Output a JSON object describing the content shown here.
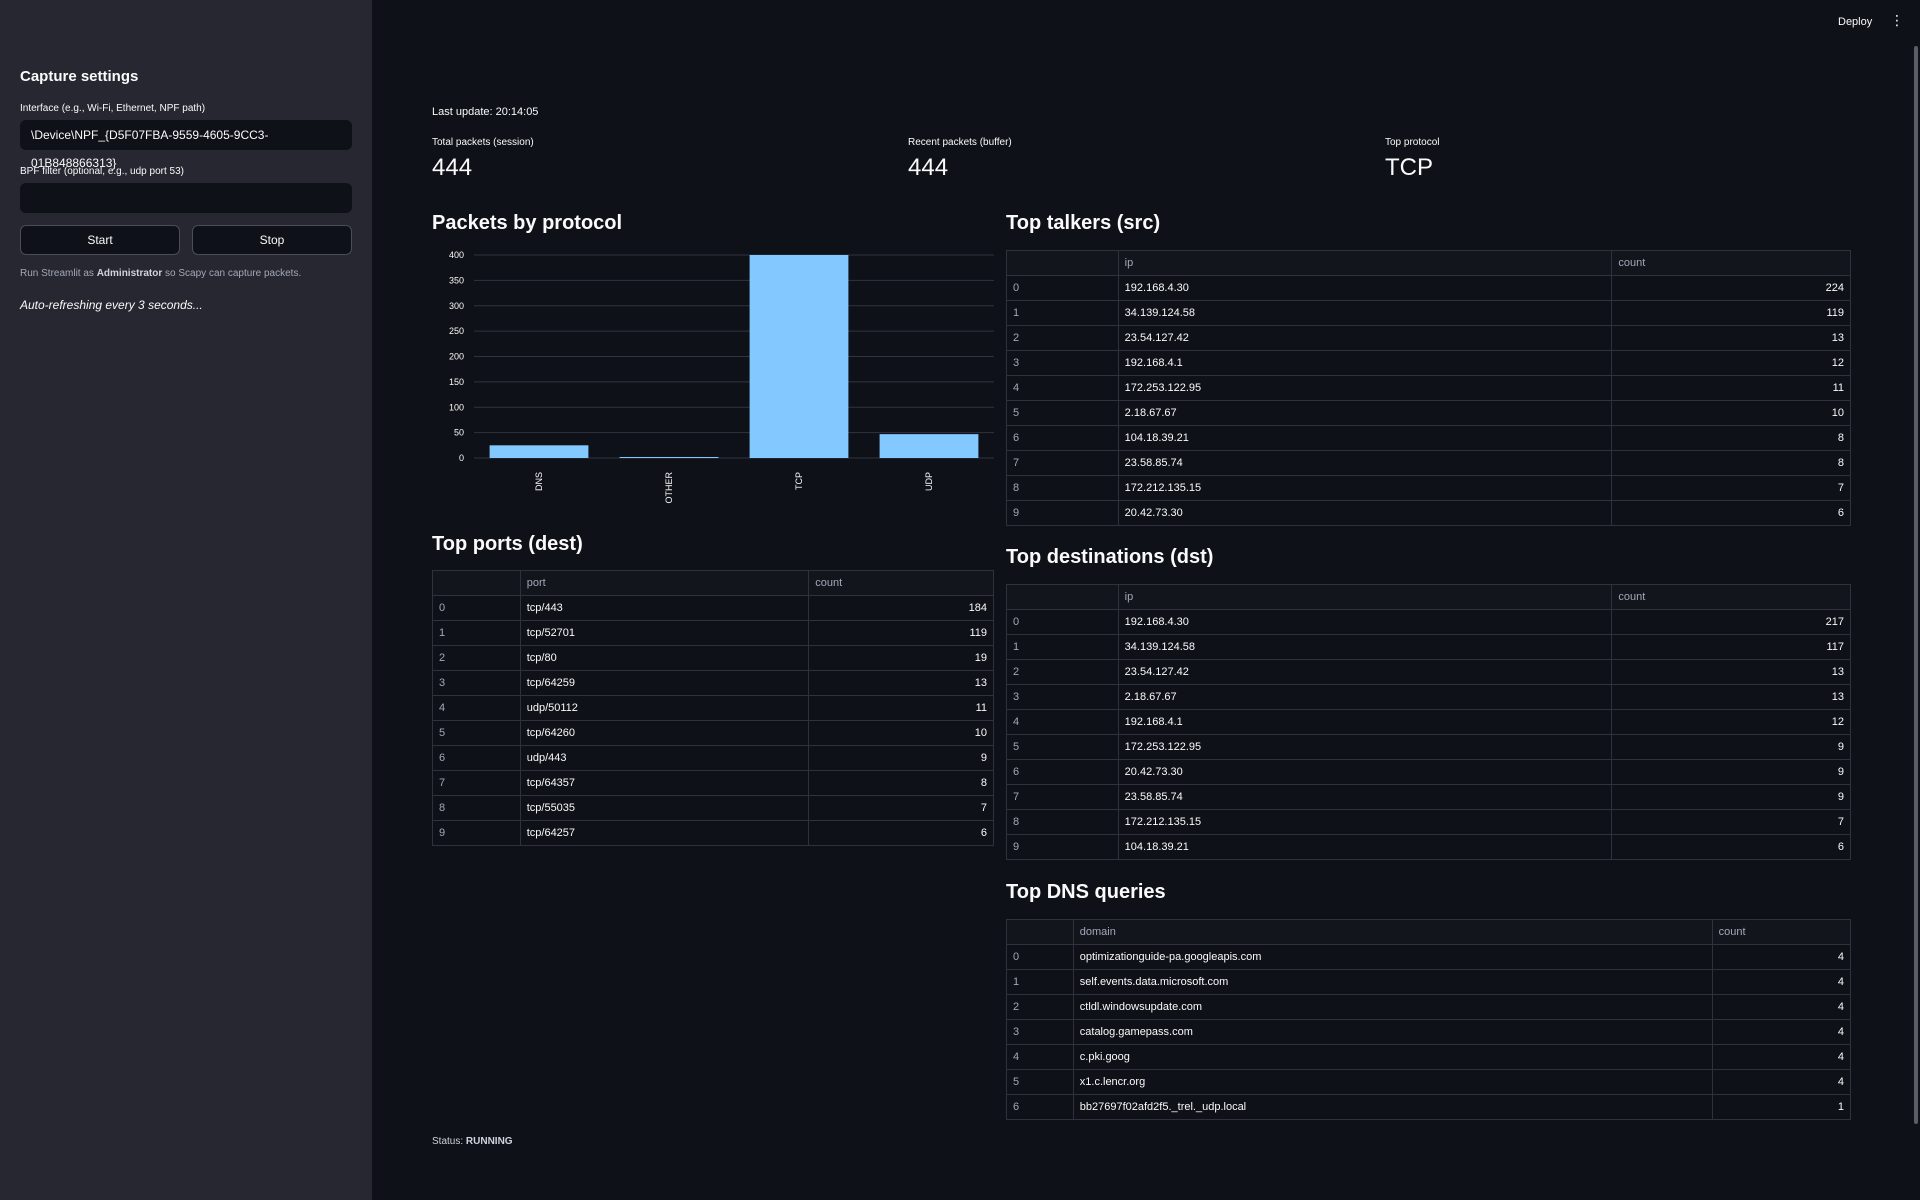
{
  "sidebar": {
    "title": "Capture settings",
    "interface_label": "Interface (e.g., Wi-Fi, Ethernet, NPF path)",
    "interface_value": "\\Device\\NPF_{D5F07FBA-9559-4605-9CC3-01B848866313}",
    "bpf_label": "BPF filter (optional, e.g., udp port 53)",
    "bpf_value": "",
    "start_label": "Start",
    "stop_label": "Stop",
    "note_prefix": "Run Streamlit as ",
    "note_bold": "Administrator",
    "note_suffix": " so Scapy can capture packets.",
    "auto_refresh": "Auto-refreshing every 3 seconds..."
  },
  "header": {
    "deploy_label": "Deploy",
    "menu_icon": "vertical-ellipsis-icon"
  },
  "main": {
    "last_update": "Last update: 20:14:05",
    "metrics": [
      {
        "label": "Total packets (session)",
        "value": "444"
      },
      {
        "label": "Recent packets (buffer)",
        "value": "444"
      },
      {
        "label": "Top protocol",
        "value": "TCP"
      }
    ],
    "packets_title": "Packets by protocol",
    "ports_title": "Top ports (dest)",
    "talkers_title": "Top talkers (src)",
    "dest_title": "Top destinations (dst)",
    "dns_title": "Top DNS queries",
    "status_prefix": "Status: ",
    "status_value": "RUNNING"
  },
  "chart_data": {
    "type": "bar",
    "categories": [
      "DNS",
      "OTHER",
      "TCP",
      "UDP"
    ],
    "values": [
      25,
      2,
      400,
      47
    ],
    "title": "",
    "xlabel": "",
    "ylabel": "",
    "ylim": [
      0,
      400
    ],
    "yticks": [
      0,
      50,
      100,
      150,
      200,
      250,
      300,
      350,
      400
    ],
    "bar_color": "#83c9ff",
    "grid": true
  },
  "tables": {
    "talkers": {
      "columns": [
        "",
        "ip",
        "count"
      ],
      "rows": [
        [
          "0",
          "192.168.4.30",
          "224"
        ],
        [
          "1",
          "34.139.124.58",
          "119"
        ],
        [
          "2",
          "23.54.127.42",
          "13"
        ],
        [
          "3",
          "192.168.4.1",
          "12"
        ],
        [
          "4",
          "172.253.122.95",
          "11"
        ],
        [
          "5",
          "2.18.67.67",
          "10"
        ],
        [
          "6",
          "104.18.39.21",
          "8"
        ],
        [
          "7",
          "23.58.85.74",
          "8"
        ],
        [
          "8",
          "172.212.135.15",
          "7"
        ],
        [
          "9",
          "20.42.73.30",
          "6"
        ]
      ]
    },
    "ports": {
      "columns": [
        "",
        "port",
        "count"
      ],
      "rows": [
        [
          "0",
          "tcp/443",
          "184"
        ],
        [
          "1",
          "tcp/52701",
          "119"
        ],
        [
          "2",
          "tcp/80",
          "19"
        ],
        [
          "3",
          "tcp/64259",
          "13"
        ],
        [
          "4",
          "udp/50112",
          "11"
        ],
        [
          "5",
          "tcp/64260",
          "10"
        ],
        [
          "6",
          "udp/443",
          "9"
        ],
        [
          "7",
          "tcp/64357",
          "8"
        ],
        [
          "8",
          "tcp/55035",
          "7"
        ],
        [
          "9",
          "tcp/64257",
          "6"
        ]
      ]
    },
    "destinations": {
      "columns": [
        "",
        "ip",
        "count"
      ],
      "rows": [
        [
          "0",
          "192.168.4.30",
          "217"
        ],
        [
          "1",
          "34.139.124.58",
          "117"
        ],
        [
          "2",
          "23.54.127.42",
          "13"
        ],
        [
          "3",
          "2.18.67.67",
          "13"
        ],
        [
          "4",
          "192.168.4.1",
          "12"
        ],
        [
          "5",
          "172.253.122.95",
          "9"
        ],
        [
          "6",
          "20.42.73.30",
          "9"
        ],
        [
          "7",
          "23.58.85.74",
          "9"
        ],
        [
          "8",
          "172.212.135.15",
          "7"
        ],
        [
          "9",
          "104.18.39.21",
          "6"
        ]
      ]
    },
    "dns": {
      "columns": [
        "",
        "domain",
        "count"
      ],
      "rows": [
        [
          "0",
          "optimizationguide-pa.googleapis.com",
          "4"
        ],
        [
          "1",
          "self.events.data.microsoft.com",
          "4"
        ],
        [
          "2",
          "ctldl.windowsupdate.com",
          "4"
        ],
        [
          "3",
          "catalog.gamepass.com",
          "4"
        ],
        [
          "4",
          "c.pki.goog",
          "4"
        ],
        [
          "5",
          "x1.c.lencr.org",
          "4"
        ],
        [
          "6",
          "bb27697f02afd2f5._trel._udp.local",
          "1"
        ]
      ]
    }
  }
}
